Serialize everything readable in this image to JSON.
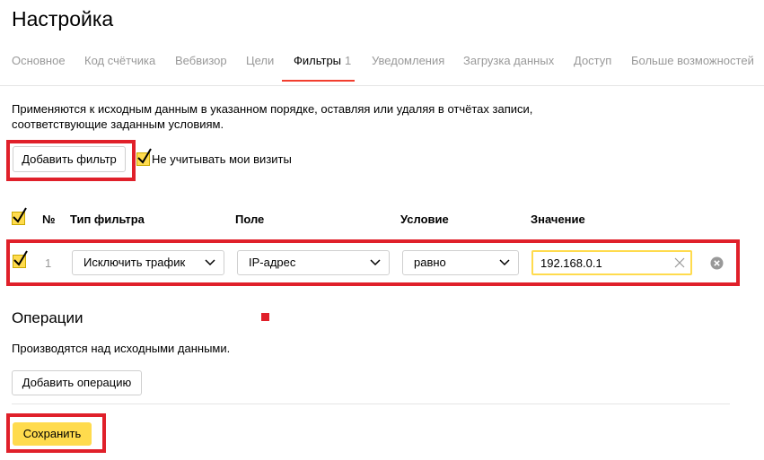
{
  "page_title": "Настройка",
  "tabs": [
    {
      "label": "Основное"
    },
    {
      "label": "Код счётчика"
    },
    {
      "label": "Вебвизор"
    },
    {
      "label": "Цели"
    },
    {
      "label": "Фильтры",
      "count": "1",
      "active": true
    },
    {
      "label": "Уведомления"
    },
    {
      "label": "Загрузка данных"
    },
    {
      "label": "Доступ"
    },
    {
      "label": "Больше возможностей"
    }
  ],
  "filters": {
    "description": "Применяются к исходным данным в указанном порядке, оставляя или удаляя в отчётах записи, соответствующие заданным условиям.",
    "add_button": "Добавить фильтр",
    "ignore_visits": {
      "label": "Не учитывать мои визиты",
      "checked": true
    },
    "table": {
      "headers": {
        "num": "№",
        "type": "Тип фильтра",
        "field": "Поле",
        "condition": "Условие",
        "value": "Значение"
      },
      "rows": [
        {
          "checked": true,
          "num": "1",
          "type": "Исключить трафик",
          "field": "IP-адрес",
          "condition": "равно",
          "value": "192.168.0.1"
        }
      ]
    }
  },
  "operations": {
    "title": "Операции",
    "description": "Производятся над исходными данными.",
    "add_button": "Добавить операцию"
  },
  "save_button": "Сохранить",
  "colors": {
    "accent": "#ffdb4d",
    "active_tab_underline": "#f23e2e",
    "highlight_frame": "#e0202a"
  }
}
